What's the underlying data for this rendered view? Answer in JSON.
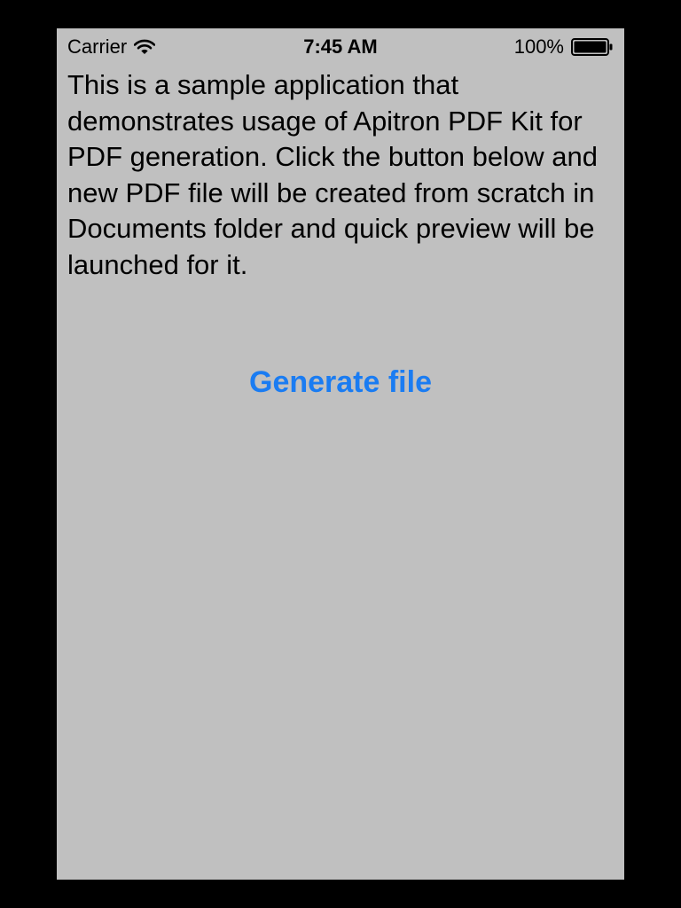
{
  "status_bar": {
    "carrier": "Carrier",
    "wifi_icon": "wifi-icon",
    "time": "7:45 AM",
    "battery_percent": "100%",
    "battery_icon": "battery-icon"
  },
  "main": {
    "description": "This is a sample application that demonstrates usage of Apitron PDF Kit for PDF generation. Click the button below and new PDF file will be created from scratch in Documents folder and quick preview will be launched for it.",
    "generate_button_label": "Generate file"
  },
  "colors": {
    "background": "#c0c0c0",
    "frame": "#000000",
    "accent": "#1a7cf2",
    "text": "#000000"
  }
}
